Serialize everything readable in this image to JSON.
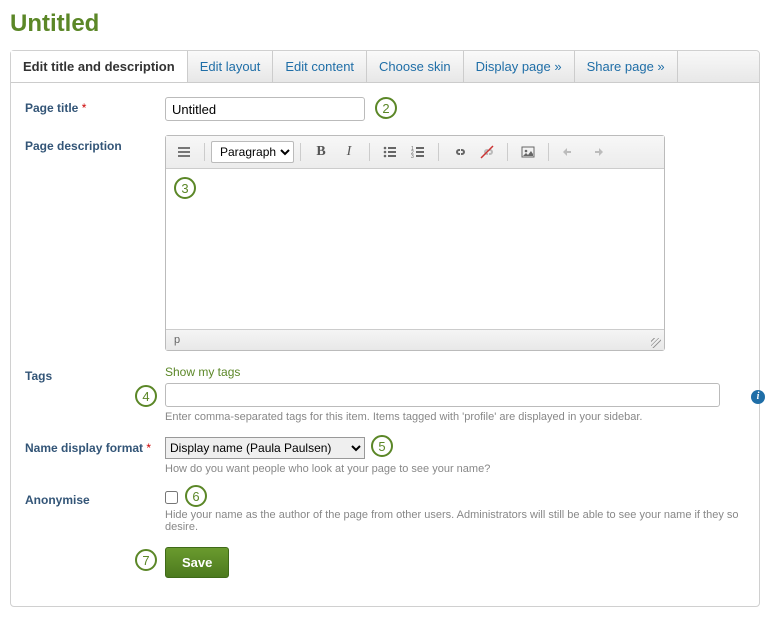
{
  "heading": "Untitled",
  "tabs": [
    {
      "label": "Edit title and description",
      "active": true
    },
    {
      "label": "Edit layout"
    },
    {
      "label": "Edit content"
    },
    {
      "label": "Choose skin"
    },
    {
      "label": "Display page »"
    },
    {
      "label": "Share page »"
    }
  ],
  "fields": {
    "title": {
      "label": "Page title",
      "required": "*",
      "value": "Untitled"
    },
    "description": {
      "label": "Page description"
    },
    "tags": {
      "label": "Tags",
      "show_link": "Show my tags",
      "help": "Enter comma-separated tags for this item. Items tagged with 'profile' are displayed in your sidebar.",
      "value": ""
    },
    "name_format": {
      "label": "Name display format",
      "required": "*",
      "selected": "Display name (Paula Paulsen)",
      "help": "How do you want people who look at your page to see your name?"
    },
    "anonymise": {
      "label": "Anonymise",
      "help": "Hide your name as the author of the page from other users. Administrators will still be able to see your name if they so desire."
    }
  },
  "editor": {
    "format_option": "Paragraph",
    "status_path": "p"
  },
  "buttons": {
    "save": "Save"
  },
  "info_badge": "i",
  "callouts": {
    "c2": "2",
    "c3": "3",
    "c4": "4",
    "c5": "5",
    "c6": "6",
    "c7": "7"
  }
}
